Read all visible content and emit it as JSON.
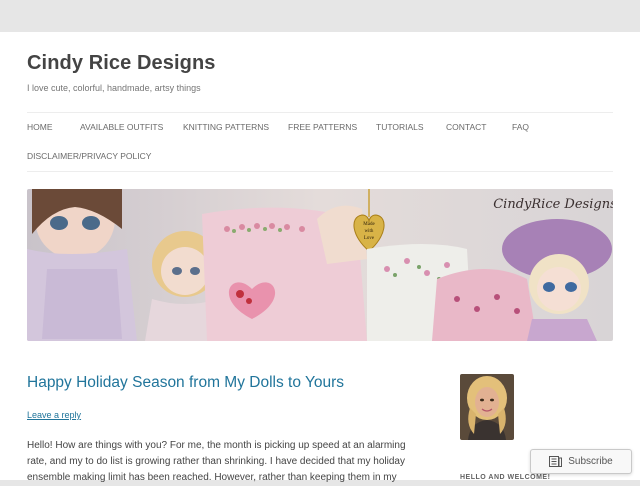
{
  "site": {
    "title": "Cindy Rice Designs",
    "tagline": "I love cute, colorful, handmade, artsy things"
  },
  "nav": {
    "items": [
      {
        "label": "HOME"
      },
      {
        "label": "AVAILABLE OUTFITS"
      },
      {
        "label": "KNITTING PATTERNS"
      },
      {
        "label": "FREE PATTERNS"
      },
      {
        "label": "TUTORIALS"
      },
      {
        "label": "CONTACT"
      },
      {
        "label": "FAQ"
      },
      {
        "label": "DISCLAIMER/PRIVACY POLICY"
      }
    ]
  },
  "banner": {
    "logo_text": "CindyRice Designs",
    "charm_text_1": "Made",
    "charm_text_2": "with",
    "charm_text_3": "Love"
  },
  "post": {
    "title": "Happy Holiday Season from My Dolls to Yours",
    "leave_reply": "Leave a reply",
    "body_line_1": "Hello! How are things with you? For me, the month is picking up speed at an alarming",
    "body_line_2": "rate, and my to do list is growing rather than shrinking. I have decided that my holiday",
    "body_line_3": "ensemble making limit has been reached. However, rather than keeping them in my"
  },
  "sidebar": {
    "widget_title": "HELLO AND WELCOME!"
  },
  "subscribe": {
    "label": "Subscribe",
    "icon": "subscribe-icon"
  },
  "colors": {
    "link": "#21759b",
    "text": "#444444",
    "outer_bg": "#e6e6e6"
  }
}
